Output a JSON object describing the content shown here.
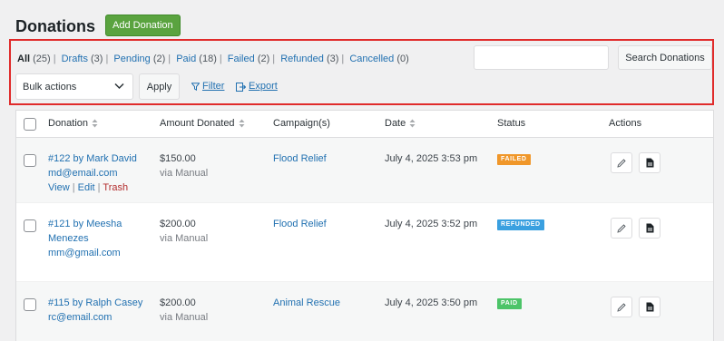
{
  "page": {
    "title": "Donations",
    "add_button": "Add Donation"
  },
  "views": [
    {
      "label": "All",
      "count": "(25)",
      "current": true
    },
    {
      "label": "Drafts",
      "count": "(3)"
    },
    {
      "label": "Pending",
      "count": "(2)"
    },
    {
      "label": "Paid",
      "count": "(18)"
    },
    {
      "label": "Failed",
      "count": "(2)"
    },
    {
      "label": "Refunded",
      "count": "(3)"
    },
    {
      "label": "Cancelled",
      "count": "(0)"
    }
  ],
  "search": {
    "value": "",
    "button": "Search Donations"
  },
  "bulk": {
    "selected": "Bulk actions",
    "apply": "Apply"
  },
  "toolbar": {
    "filter": "Filter",
    "export": "Export"
  },
  "columns": {
    "donation": "Donation",
    "amount": "Amount Donated",
    "campaign": "Campaign(s)",
    "date": "Date",
    "status": "Status",
    "actions": "Actions"
  },
  "rows": [
    {
      "title_line1": "#122 by Mark David",
      "title_line2": "",
      "email": "md@email.com",
      "amount": "$150.00",
      "method": "via Manual",
      "campaign": "Flood Relief",
      "date": "July 4, 2025 3:53 pm",
      "status": "FAILED",
      "status_color": "#f0972a",
      "row_actions": {
        "view": "View",
        "edit": "Edit",
        "trash": "Trash",
        "sep": "|"
      }
    },
    {
      "title_line1": "#121 by Meesha",
      "title_line2": "Menezes",
      "email": "mm@gmail.com",
      "amount": "$200.00",
      "method": "via Manual",
      "campaign": "Flood Relief",
      "date": "July 4, 2025 3:52 pm",
      "status": "REFUNDED",
      "status_color": "#3aa0e0"
    },
    {
      "title_line1": "#115 by Ralph Casey",
      "title_line2": "",
      "email": "rc@email.com",
      "amount": "$200.00",
      "method": "via Manual",
      "campaign": "Animal Rescue",
      "date": "July 4, 2025 3:50 pm",
      "status": "PAID",
      "status_color": "#4cc468"
    }
  ]
}
